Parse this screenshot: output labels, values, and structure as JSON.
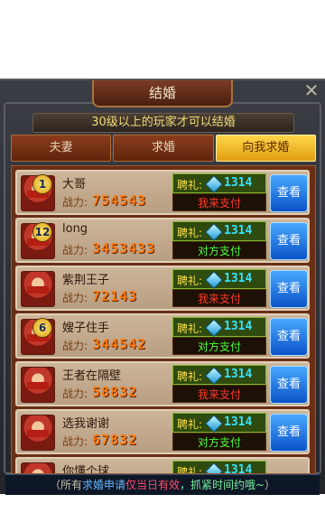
{
  "window": {
    "title": "结婚"
  },
  "notice": "30级以上的玩家才可以结婚",
  "tabs": [
    {
      "label": "夫妻"
    },
    {
      "label": "求婚"
    },
    {
      "label": "向我求婚"
    }
  ],
  "labels": {
    "power": "战力:",
    "gift": "聘礼:",
    "view": "查看"
  },
  "colors": {
    "active_tab": "#ffd64a",
    "pay_me": "#ff3a2a",
    "pay_them": "#4fff3a",
    "gem": "#35e2ff"
  },
  "proposals": [
    {
      "badge": "1",
      "name": "大哥",
      "power": "754543",
      "gift": "1314",
      "payer": "我来支付"
    },
    {
      "badge": "12",
      "name": "long",
      "power": "3453433",
      "gift": "1314",
      "payer": "对方支付"
    },
    {
      "badge": "",
      "name": "紫荆王子",
      "power": "72143",
      "gift": "1314",
      "payer": "我来支付"
    },
    {
      "badge": "6",
      "name": "嫂子住手",
      "power": "344542",
      "gift": "1314",
      "payer": "对方支付"
    },
    {
      "badge": "",
      "name": "王者在隔壁",
      "power": "58832",
      "gift": "1314",
      "payer": "我来支付"
    },
    {
      "badge": "",
      "name": "选我谢谢",
      "power": "67832",
      "gift": "1314",
      "payer": "对方支付"
    },
    {
      "badge": "",
      "name": "你懂个球",
      "power": "",
      "gift": "1314",
      "payer": ""
    }
  ],
  "footer": {
    "open": "（所有",
    "w1": "求婚申请",
    "w2": "仅当日有效",
    "w3": "，抓紧时间约哦~",
    "close": "）"
  }
}
